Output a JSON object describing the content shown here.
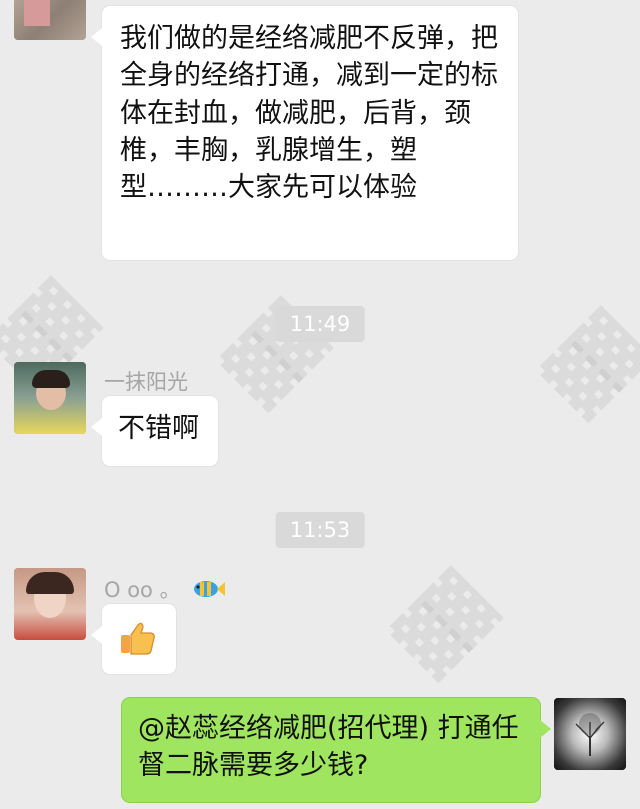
{
  "messages": {
    "m1": "我们做的是经络减肥不反弹，把全身的经络打通，减到一定的标体在封血，做减肥，后背，颈椎，丰胸，乳腺增生，塑型………大家先可以体验",
    "time1": "11:49",
    "sender2": "一抹阳光",
    "m2": "不错啊",
    "time2": "11:53",
    "sender3": "O oo 。",
    "m3_icon": "thumbs-up-emoji",
    "m4": "@赵蕊经络减肥(招代理) 打通任督二脉需要多少钱?"
  },
  "colors": {
    "background": "#ebebeb",
    "bubble_left": "#ffffff",
    "bubble_right": "#9fe55f",
    "time_badge": "#d9d9d9"
  }
}
